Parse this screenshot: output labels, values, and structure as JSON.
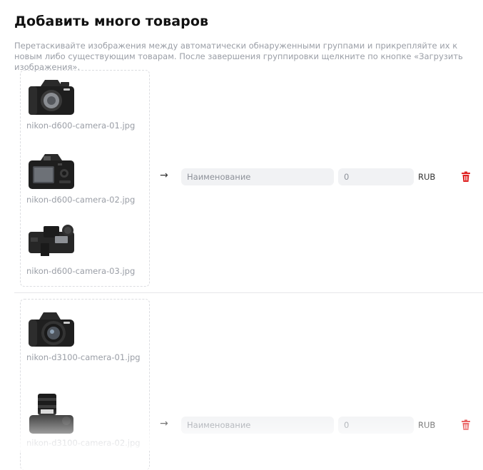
{
  "page": {
    "title": "Добавить много товаров",
    "intro": "Перетаскивайте изображения между автоматически обнаруженными группами и прикрепляйте их к новым либо существующим товарам. После завершения группировки щелкните по кнопке «Загрузить изображения»."
  },
  "groups": [
    {
      "images": [
        {
          "filename": "nikon-d600-camera-01.jpg",
          "icon": "camera-front-icon"
        },
        {
          "filename": "nikon-d600-camera-02.jpg",
          "icon": "camera-back-icon"
        },
        {
          "filename": "nikon-d600-camera-03.jpg",
          "icon": "camera-top-icon"
        }
      ],
      "product": {
        "name_placeholder": "Наименование",
        "price_placeholder": "0",
        "currency": "RUB"
      }
    },
    {
      "images": [
        {
          "filename": "nikon-d3100-camera-01.jpg",
          "icon": "camera-lens-front-icon"
        },
        {
          "filename": "nikon-d3100-camera-02.jpg",
          "icon": "camera-lens-top-icon"
        }
      ],
      "product": {
        "name_placeholder": "Наименование",
        "price_placeholder": "0",
        "currency": "RUB"
      }
    }
  ],
  "icons": {
    "arrow": "→",
    "delete": "trash-icon"
  },
  "colors": {
    "delete_icon": "#e02424",
    "muted_text": "#9a9ea6",
    "input_bg": "#f1f2f4"
  }
}
